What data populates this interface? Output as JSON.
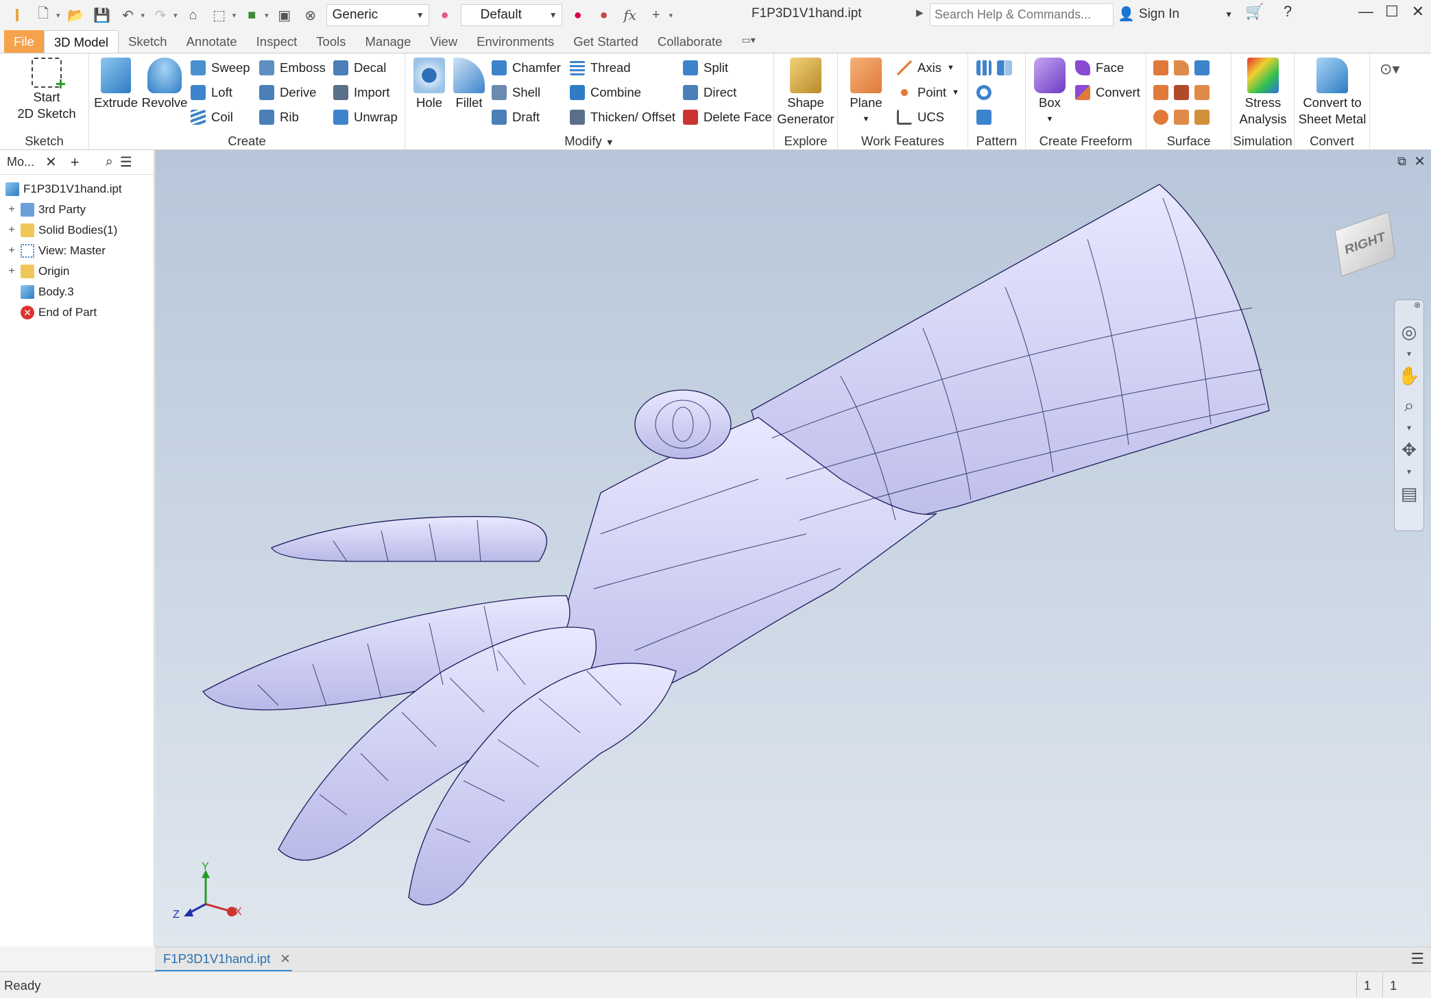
{
  "titlebar": {
    "material": "Generic",
    "appearance": "Default",
    "document_title": "F1P3D1V1hand.ipt",
    "search_placeholder": "Search Help & Commands...",
    "sign_in": "Sign In"
  },
  "tabs": [
    "File",
    "3D Model",
    "Sketch",
    "Annotate",
    "Inspect",
    "Tools",
    "Manage",
    "View",
    "Environments",
    "Get Started",
    "Collaborate"
  ],
  "ribbon": {
    "sketch": {
      "title": "Sketch",
      "start_line1": "Start",
      "start_line2": "2D Sketch"
    },
    "create": {
      "title": "Create",
      "extrude": "Extrude",
      "revolve": "Revolve",
      "sweep": "Sweep",
      "loft": "Loft",
      "coil": "Coil",
      "emboss": "Emboss",
      "derive": "Derive",
      "rib": "Rib",
      "decal": "Decal",
      "import": "Import",
      "unwrap": "Unwrap"
    },
    "modify": {
      "title": "Modify",
      "hole": "Hole",
      "fillet": "Fillet",
      "chamfer": "Chamfer",
      "shell": "Shell",
      "draft": "Draft",
      "thread": "Thread",
      "combine": "Combine",
      "thicken": "Thicken/ Offset",
      "split": "Split",
      "direct": "Direct",
      "delete_face": "Delete Face"
    },
    "explore": {
      "title": "Explore",
      "shape_line1": "Shape",
      "shape_line2": "Generator"
    },
    "work_features": {
      "title": "Work Features",
      "plane": "Plane",
      "axis": "Axis",
      "point": "Point",
      "ucs": "UCS"
    },
    "pattern": {
      "title": "Pattern"
    },
    "freeform": {
      "title": "Create Freeform",
      "box": "Box",
      "face": "Face",
      "convert": "Convert"
    },
    "surface": {
      "title": "Surface"
    },
    "simulation": {
      "title": "Simulation",
      "stress_line1": "Stress",
      "stress_line2": "Analysis"
    },
    "convert": {
      "title": "Convert",
      "sheet_line1": "Convert to",
      "sheet_line2": "Sheet Metal"
    }
  },
  "browser": {
    "tab_label": "Mo...",
    "nodes": [
      {
        "label": "F1P3D1V1hand.ipt",
        "icon": "part-icon"
      },
      {
        "label": "3rd Party",
        "icon": "third-party-icon"
      },
      {
        "label": "Solid Bodies(1)",
        "icon": "folder-icon"
      },
      {
        "label": "View: Master",
        "icon": "view-icon"
      },
      {
        "label": "Origin",
        "icon": "folder-icon"
      },
      {
        "label": "Body.3",
        "icon": "body-icon"
      },
      {
        "label": "End of Part",
        "icon": "end-of-part-icon"
      }
    ]
  },
  "viewport": {
    "viewcube_face": "RIGHT",
    "axis_labels": {
      "x": "X",
      "y": "Y",
      "z": "Z"
    }
  },
  "document_tab": "F1P3D1V1hand.ipt",
  "status": {
    "text": "Ready",
    "count1": "1",
    "count2": "1"
  },
  "colors": {
    "file_tab": "#f6a24b",
    "accent": "#3b8fd7",
    "mesh": "#dcdcff"
  }
}
